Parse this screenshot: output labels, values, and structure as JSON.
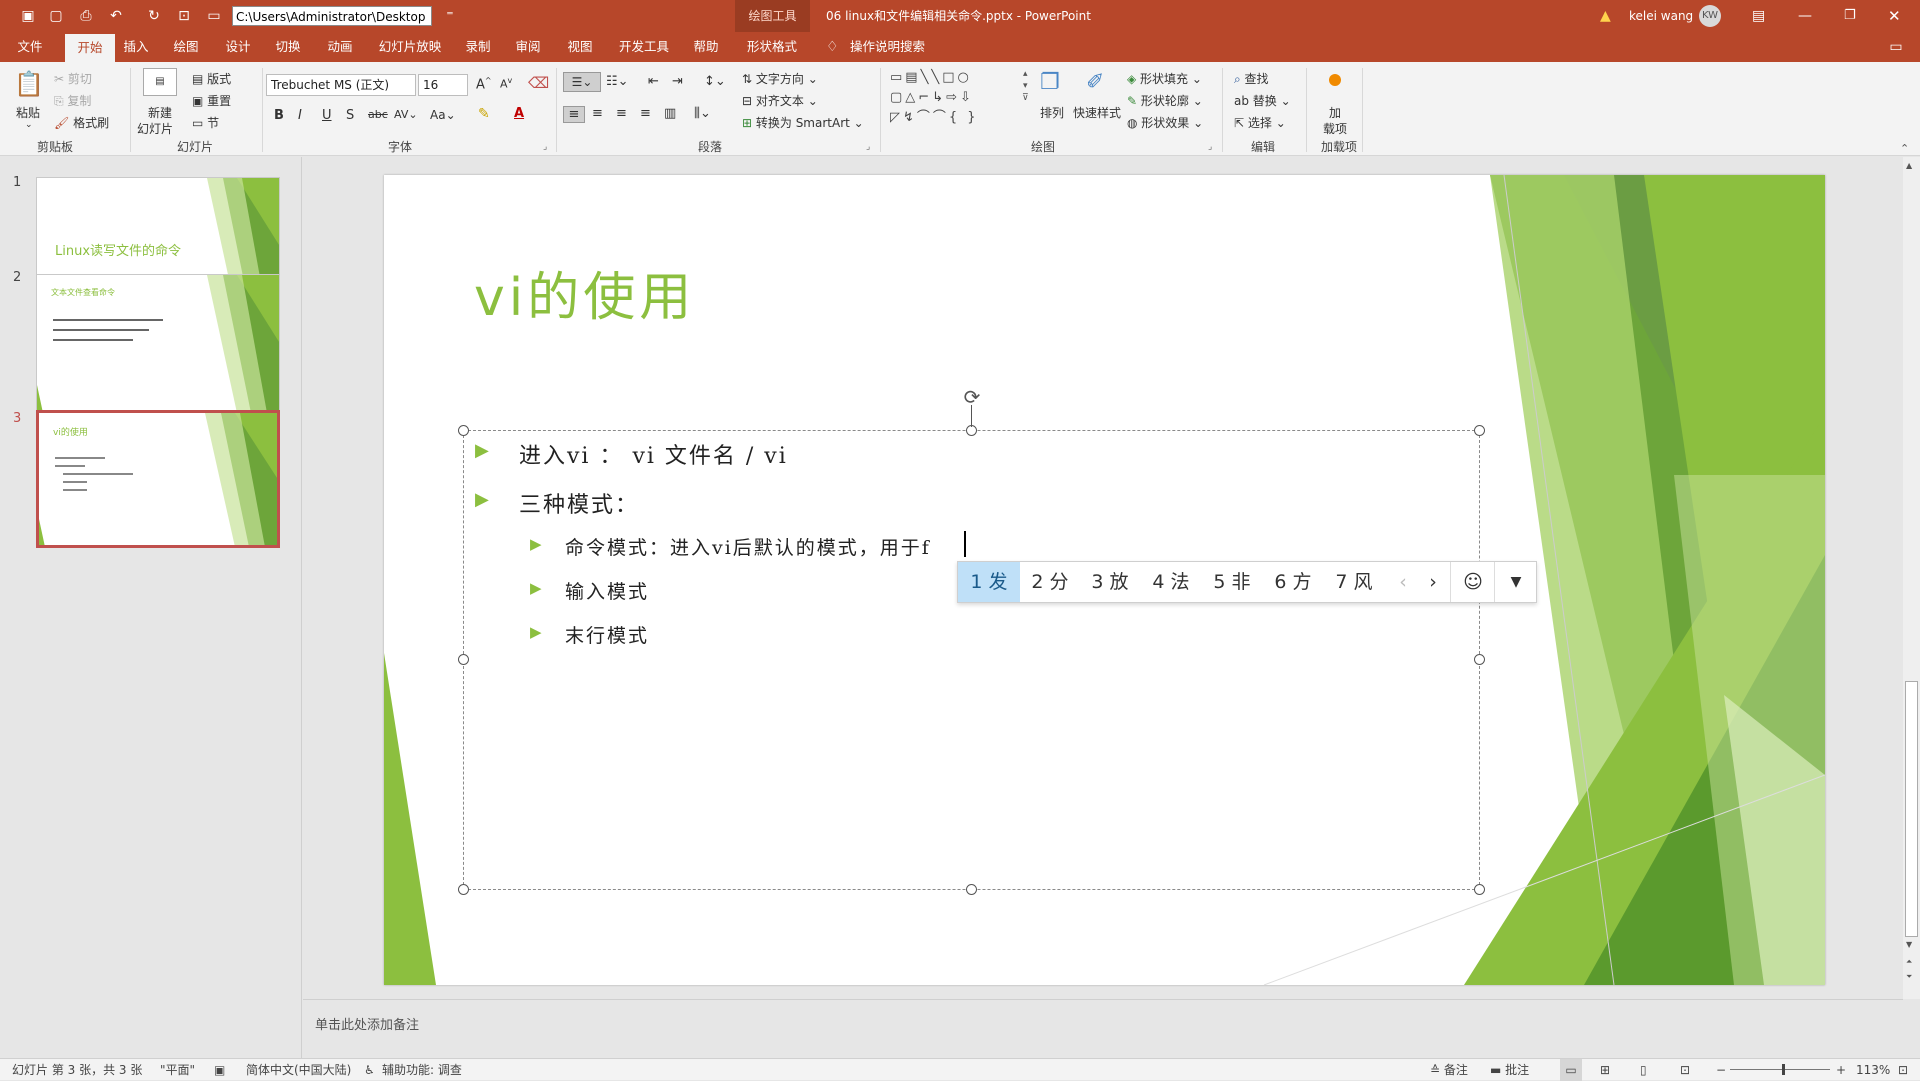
{
  "titlebar": {
    "path": "C:\\Users\\Administrator\\Desktop",
    "context_tools": "绘图工具",
    "document_title": "06 linux和文件编辑相关命令.pptx - PowerPoint",
    "user_name": "kelei wang",
    "user_initials": "KW"
  },
  "menu": {
    "tabs": [
      "文件",
      "开始",
      "插入",
      "绘图",
      "设计",
      "切换",
      "动画",
      "幻灯片放映",
      "录制",
      "审阅",
      "视图",
      "开发工具",
      "帮助",
      "形状格式"
    ],
    "search": "操作说明搜索"
  },
  "ribbon": {
    "clipboard": {
      "paste": "粘贴",
      "cut": "剪切",
      "copy": "复制",
      "format_painter": "格式刷",
      "label": "剪贴板"
    },
    "slides": {
      "new_slide_line1": "新建",
      "new_slide_line2": "幻灯片",
      "layout": "版式",
      "reset": "重置",
      "section": "节",
      "label": "幻灯片"
    },
    "font": {
      "font_name": "Trebuchet MS (正文)",
      "font_size": "16",
      "label": "字体"
    },
    "paragraph": {
      "text_direction": "文字方向",
      "align_text": "对齐文本",
      "smartart": "转换为 SmartArt",
      "label": "段落"
    },
    "drawing": {
      "arrange": "排列",
      "quick_styles": "快速样式",
      "shape_fill": "形状填充",
      "shape_outline": "形状轮廓",
      "shape_effects": "形状效果",
      "label": "绘图"
    },
    "editing": {
      "find": "查找",
      "replace": "替换",
      "select": "选择",
      "label": "编辑"
    },
    "addins": {
      "addin_line1": "加",
      "addin_line2": "载项",
      "label": "加载项"
    }
  },
  "thumbnails": [
    {
      "num": "1",
      "title": "Linux读写文件的命令"
    },
    {
      "num": "2",
      "title": "文本文件查看命令"
    },
    {
      "num": "3",
      "title": "vi的使用"
    }
  ],
  "slide": {
    "title": "vi的使用",
    "bullets": [
      {
        "text": "进入vi ： vi 文件名 / vi"
      },
      {
        "text": "三种模式："
      }
    ],
    "sub_bullets": [
      {
        "text": "命令模式：进入vi后默认的模式，用于f"
      },
      {
        "text": "输入模式"
      },
      {
        "text": "末行模式"
      }
    ]
  },
  "ime": {
    "candidates": [
      "1 发",
      "2 分",
      "3 放",
      "4 法",
      "5 非",
      "6 方",
      "7 风"
    ]
  },
  "notes": {
    "placeholder": "单击此处添加备注"
  },
  "status": {
    "slide_info": "幻灯片 第 3 张，共 3 张",
    "theme": "\"平面\"",
    "language": "简体中文(中国大陆)",
    "accessibility": "辅助功能: 调查",
    "notes_btn": "备注",
    "comments_btn": "批注",
    "zoom": "113%"
  },
  "colors": {
    "accent": "#b7472a",
    "slide_green": "#8cbf3f"
  }
}
